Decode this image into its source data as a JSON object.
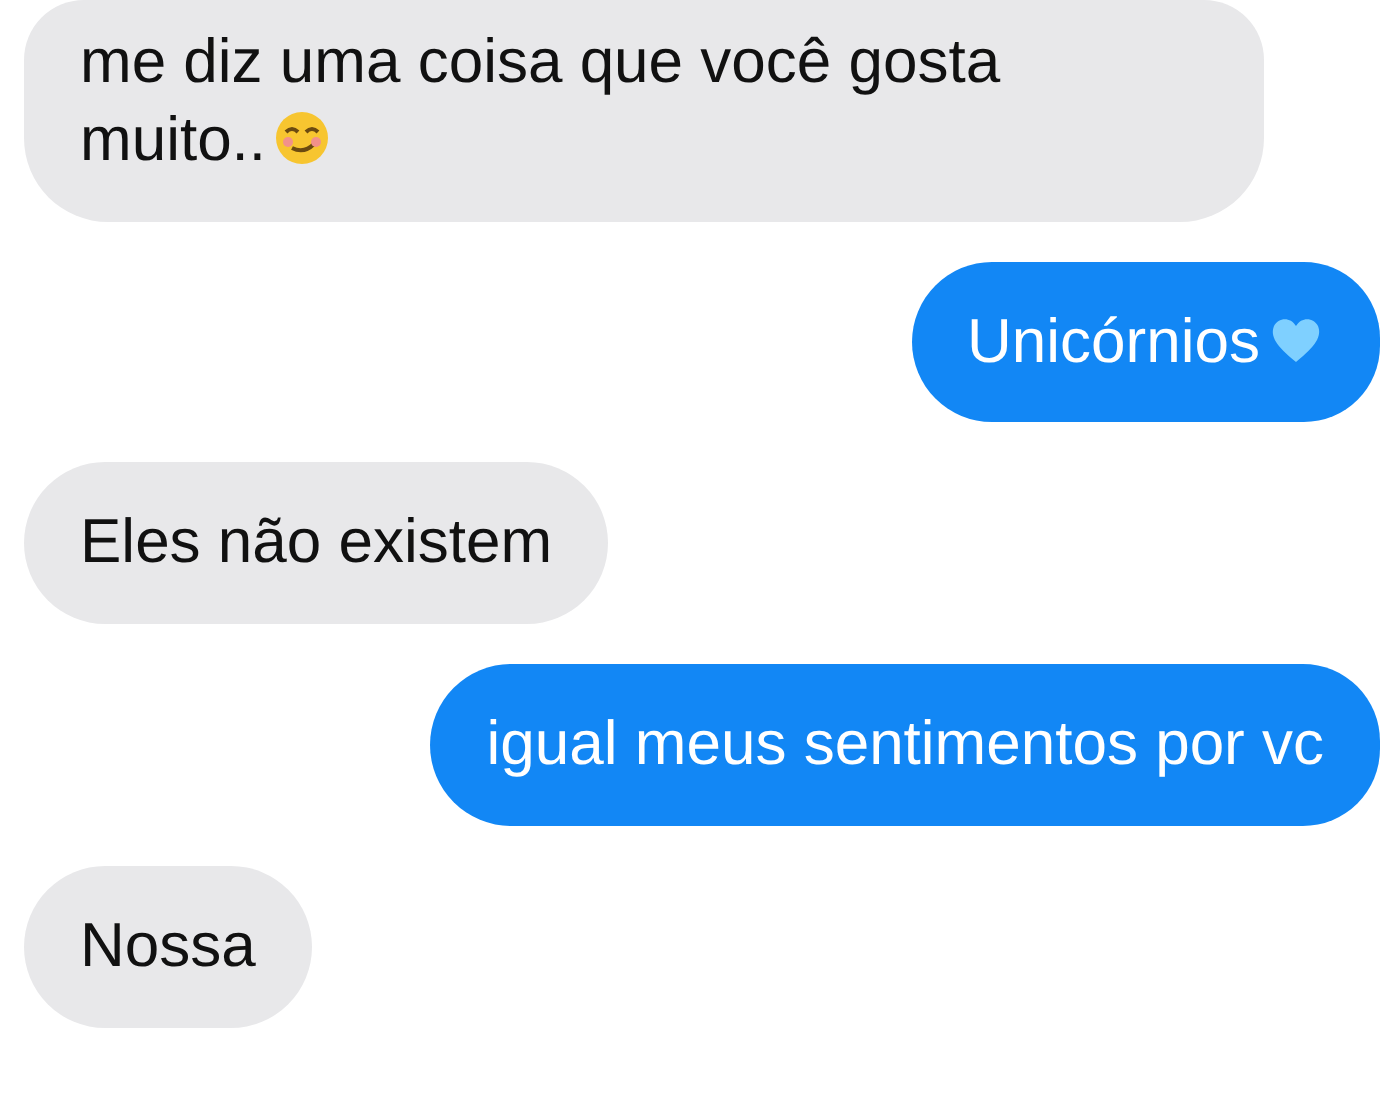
{
  "messages": [
    {
      "sent": false,
      "kind": "smirk",
      "text": "me diz uma coisa que você gosta muito.."
    },
    {
      "sent": true,
      "kind": "heart",
      "text": "Unicórnios"
    },
    {
      "sent": false,
      "kind": "plain",
      "text": "Eles não existem"
    },
    {
      "sent": true,
      "kind": "plain",
      "text": "igual meus sentimentos por vc"
    },
    {
      "sent": false,
      "kind": "plain",
      "text": "Nossa"
    }
  ]
}
